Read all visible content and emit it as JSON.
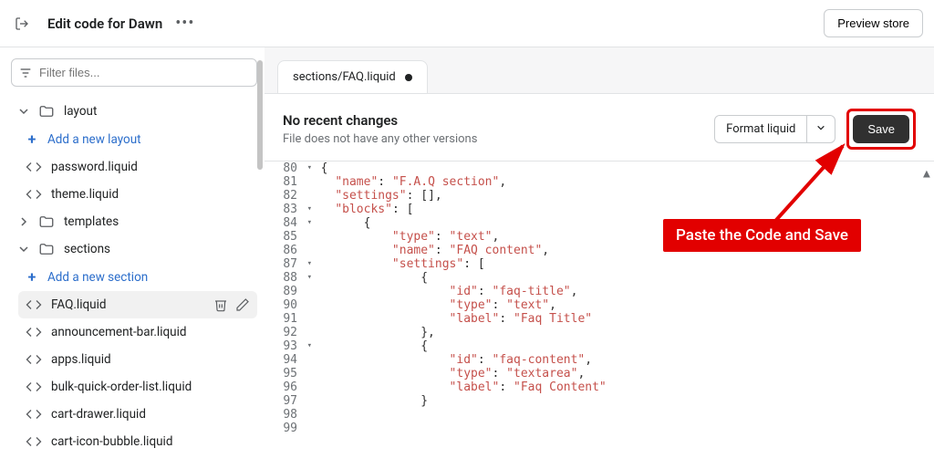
{
  "header": {
    "title": "Edit code for Dawn",
    "preview_btn": "Preview store"
  },
  "sidebar": {
    "filter_placeholder": "Filter files...",
    "folders": {
      "layout": "layout",
      "templates": "templates",
      "sections": "sections"
    },
    "add_layout": "Add a new layout",
    "add_section": "Add a new section",
    "files": {
      "password": "password.liquid",
      "theme": "theme.liquid",
      "faq": "FAQ.liquid",
      "announcement": "announcement-bar.liquid",
      "apps": "apps.liquid",
      "bulk": "bulk-quick-order-list.liquid",
      "cart_drawer": "cart-drawer.liquid",
      "cart_icon": "cart-icon-bubble.liquid"
    }
  },
  "tab": {
    "label": "sections/FAQ.liquid"
  },
  "editor_header": {
    "title": "No recent changes",
    "subtitle": "File does not have any other versions",
    "format_btn": "Format liquid",
    "save_btn": "Save"
  },
  "code_lines": [
    {
      "n": 80,
      "fold": true,
      "indent": 2,
      "tokens": [
        {
          "t": "p",
          "v": "{"
        }
      ]
    },
    {
      "n": 81,
      "indent": 4,
      "tokens": [
        {
          "t": "k",
          "v": "\"name\""
        },
        {
          "t": "p",
          "v": ": "
        },
        {
          "t": "k",
          "v": "\"F.A.Q section\""
        },
        {
          "t": "p",
          "v": ","
        }
      ]
    },
    {
      "n": 82,
      "indent": 4,
      "tokens": [
        {
          "t": "k",
          "v": "\"settings\""
        },
        {
          "t": "p",
          "v": ": [],"
        }
      ]
    },
    {
      "n": 83,
      "fold": true,
      "indent": 4,
      "tokens": [
        {
          "t": "k",
          "v": "\"blocks\""
        },
        {
          "t": "p",
          "v": ": ["
        }
      ]
    },
    {
      "n": 84,
      "fold": true,
      "indent": 8,
      "tokens": [
        {
          "t": "p",
          "v": "{"
        }
      ]
    },
    {
      "n": 85,
      "indent": 12,
      "tokens": [
        {
          "t": "k",
          "v": "\"type\""
        },
        {
          "t": "p",
          "v": ": "
        },
        {
          "t": "k",
          "v": "\"text\""
        },
        {
          "t": "p",
          "v": ","
        }
      ]
    },
    {
      "n": 86,
      "indent": 12,
      "tokens": [
        {
          "t": "k",
          "v": "\"name\""
        },
        {
          "t": "p",
          "v": ": "
        },
        {
          "t": "k",
          "v": "\"FAQ content\""
        },
        {
          "t": "p",
          "v": ","
        }
      ]
    },
    {
      "n": 87,
      "fold": true,
      "indent": 12,
      "tokens": [
        {
          "t": "k",
          "v": "\"settings\""
        },
        {
          "t": "p",
          "v": ": ["
        }
      ]
    },
    {
      "n": 88,
      "fold": true,
      "indent": 16,
      "tokens": [
        {
          "t": "p",
          "v": "{"
        }
      ]
    },
    {
      "n": 89,
      "indent": 20,
      "tokens": [
        {
          "t": "k",
          "v": "\"id\""
        },
        {
          "t": "p",
          "v": ": "
        },
        {
          "t": "k",
          "v": "\"faq-title\""
        },
        {
          "t": "p",
          "v": ","
        }
      ]
    },
    {
      "n": 90,
      "indent": 20,
      "tokens": [
        {
          "t": "k",
          "v": "\"type\""
        },
        {
          "t": "p",
          "v": ": "
        },
        {
          "t": "k",
          "v": "\"text\""
        },
        {
          "t": "p",
          "v": ","
        }
      ]
    },
    {
      "n": 91,
      "indent": 20,
      "tokens": [
        {
          "t": "k",
          "v": "\"label\""
        },
        {
          "t": "p",
          "v": ": "
        },
        {
          "t": "k",
          "v": "\"Faq Title\""
        }
      ]
    },
    {
      "n": 92,
      "indent": 16,
      "tokens": [
        {
          "t": "p",
          "v": "},"
        }
      ]
    },
    {
      "n": 93,
      "fold": true,
      "indent": 16,
      "tokens": [
        {
          "t": "p",
          "v": "{"
        }
      ]
    },
    {
      "n": 94,
      "indent": 20,
      "tokens": [
        {
          "t": "k",
          "v": "\"id\""
        },
        {
          "t": "p",
          "v": ": "
        },
        {
          "t": "k",
          "v": "\"faq-content\""
        },
        {
          "t": "p",
          "v": ","
        }
      ]
    },
    {
      "n": 95,
      "indent": 20,
      "tokens": [
        {
          "t": "k",
          "v": "\"type\""
        },
        {
          "t": "p",
          "v": ": "
        },
        {
          "t": "k",
          "v": "\"textarea\""
        },
        {
          "t": "p",
          "v": ","
        }
      ]
    },
    {
      "n": 96,
      "indent": 20,
      "tokens": [
        {
          "t": "k",
          "v": "\"label\""
        },
        {
          "t": "p",
          "v": ": "
        },
        {
          "t": "k",
          "v": "\"Faq Content\""
        }
      ]
    },
    {
      "n": 97,
      "indent": 16,
      "tokens": [
        {
          "t": "p",
          "v": "}"
        }
      ]
    },
    {
      "n": 98,
      "indent": 0,
      "tokens": []
    },
    {
      "n": 99,
      "indent": 0,
      "tokens": []
    }
  ],
  "annotation": "Paste the Code and Save"
}
